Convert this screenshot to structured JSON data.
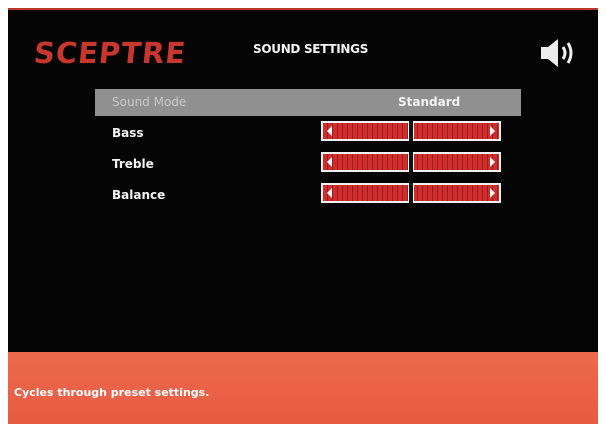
{
  "header": {
    "logo_text": "SCEPTRE",
    "title": "SOUND SETTINGS",
    "icon": "speaker-volume-icon"
  },
  "menu": {
    "sound_mode": {
      "label": "Sound Mode",
      "value": "Standard"
    },
    "bass": {
      "label": "Bass",
      "level": 0.5
    },
    "treble": {
      "label": "Treble",
      "level": 0.5
    },
    "balance": {
      "label": "Balance",
      "level": 0.5
    }
  },
  "footer": {
    "hint": "Cycles through preset settings."
  },
  "colors": {
    "brand_red": "#c8372d",
    "slider_red": "#d02e2c",
    "highlight_gray": "#909090",
    "footer_orange": "#ee6a4f"
  }
}
